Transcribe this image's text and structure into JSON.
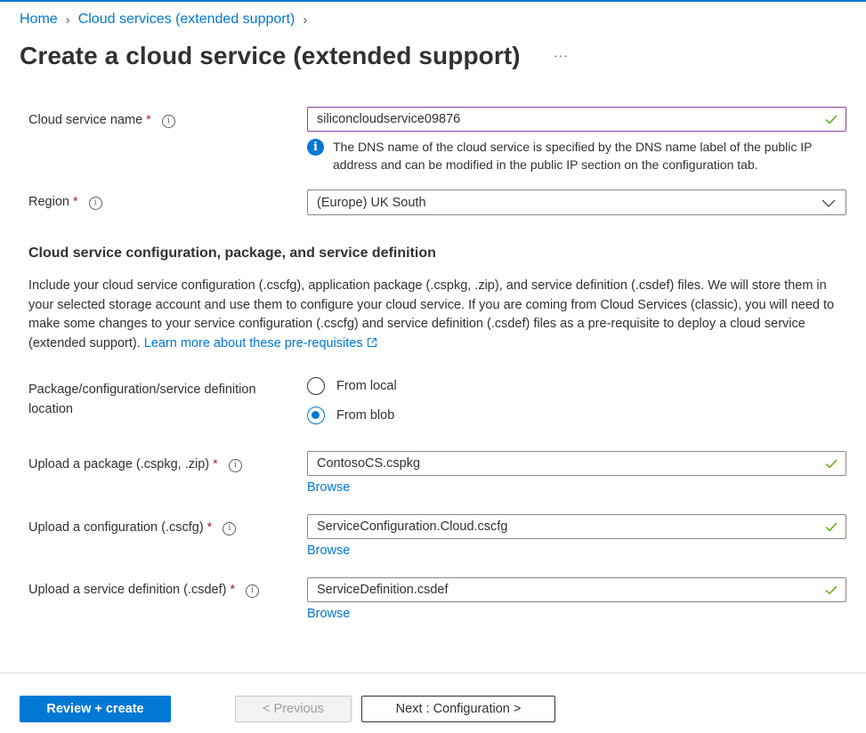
{
  "breadcrumb": {
    "items": [
      {
        "label": "Home"
      },
      {
        "label": "Cloud services (extended support)"
      }
    ]
  },
  "page": {
    "title": "Create a cloud service (extended support)",
    "more_label": "···"
  },
  "form": {
    "cloud_service_name": {
      "label": "Cloud service name",
      "required_mark": "*",
      "value": "siliconcloudservice09876",
      "valid": true,
      "note": "The DNS name of the cloud service is specified by the DNS name label of the public IP address and can be modified in the public IP section on the configuration tab."
    },
    "region": {
      "label": "Region",
      "required_mark": "*",
      "selected": "(Europe) UK South"
    },
    "section": {
      "title": "Cloud service configuration, package, and service definition",
      "description": "Include your cloud service configuration (.cscfg), application package (.cspkg, .zip), and service definition (.csdef) files. We will store them in your selected storage account and use them to configure your cloud service. If you are coming from Cloud Services (classic), you will need to make some changes to your service configuration (.cscfg) and service definition (.csdef) files as a pre-requisite to deploy a cloud service (extended support).",
      "link_label": "Learn more about these pre-requisites"
    },
    "location": {
      "label": "Package/configuration/service definition location",
      "options": [
        {
          "label": "From local",
          "checked": false
        },
        {
          "label": "From blob",
          "checked": true
        }
      ]
    },
    "package": {
      "label": "Upload a package (.cspkg, .zip)",
      "required_mark": "*",
      "value": "ContosoCS.cspkg",
      "valid": true,
      "browse_label": "Browse"
    },
    "configuration": {
      "label": "Upload a configuration (.cscfg)",
      "required_mark": "*",
      "value": "ServiceConfiguration.Cloud.cscfg",
      "valid": true,
      "browse_label": "Browse"
    },
    "definition": {
      "label": "Upload a service definition (.csdef)",
      "required_mark": "*",
      "value": "ServiceDefinition.csdef",
      "valid": true,
      "browse_label": "Browse"
    }
  },
  "footer": {
    "review_create_label": "Review + create",
    "previous_label": "< Previous",
    "next_label": "Next : Configuration >"
  },
  "colors": {
    "accent": "#0078d4",
    "required": "#a4262c",
    "valid_check": "#57a300",
    "focus_border": "#8a3ea5"
  }
}
